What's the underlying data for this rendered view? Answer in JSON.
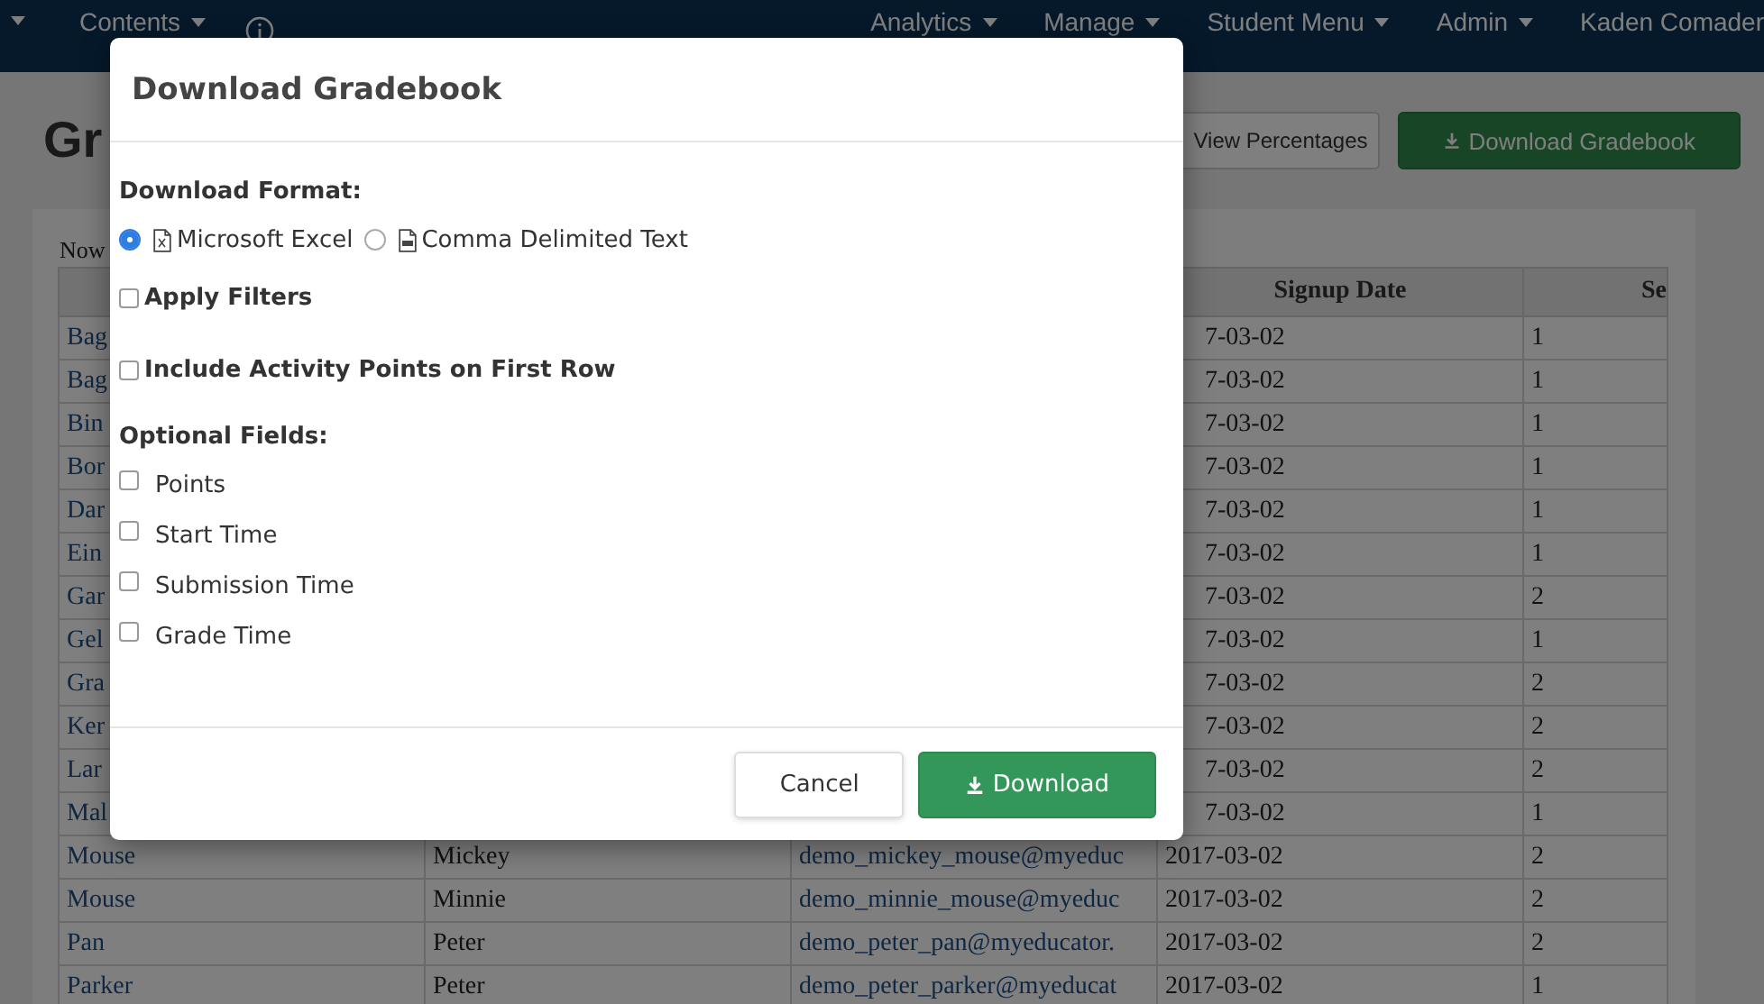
{
  "nav": {
    "left": [
      {
        "label": "Contents",
        "dropdown": true
      }
    ],
    "right": [
      {
        "label": "Analytics",
        "dropdown": true
      },
      {
        "label": "Manage",
        "dropdown": true
      },
      {
        "label": "Student Menu",
        "dropdown": true
      },
      {
        "label": "Admin",
        "dropdown": true
      },
      {
        "label": "Kaden Comader",
        "dropdown": false
      }
    ]
  },
  "page": {
    "title": "Gr",
    "buttons": [
      {
        "label": "View Percentages",
        "kind": "default"
      },
      {
        "label": "Download Gradebook",
        "kind": "primary"
      }
    ]
  },
  "summary": "Now",
  "table": {
    "columns": [
      {
        "label": "Signup Date"
      },
      {
        "label": "Se"
      }
    ],
    "rows": [
      {
        "column_1": "Bag",
        "column_4": "7-03-02",
        "column_5": "1"
      },
      {
        "column_1": "Bag",
        "column_4": "7-03-02",
        "column_5": "1"
      },
      {
        "column_1": "Bin",
        "column_4": "7-03-02",
        "column_5": "1"
      },
      {
        "column_1": "Bor",
        "column_4": "7-03-02",
        "column_5": "1"
      },
      {
        "column_1": "Dar",
        "column_4": "7-03-02",
        "column_5": "1"
      },
      {
        "column_1": "Ein",
        "column_4": "7-03-02",
        "column_5": "1"
      },
      {
        "column_1": "Gar",
        "column_4": "7-03-02",
        "column_5": "2"
      },
      {
        "column_1": "Gel",
        "column_4": "7-03-02",
        "column_5": "1"
      },
      {
        "column_1": "Gra",
        "column_4": "7-03-02",
        "column_5": "2"
      },
      {
        "column_1": "Ker",
        "column_4": "7-03-02",
        "column_5": "2"
      },
      {
        "column_1": "Lar",
        "column_4": "7-03-02",
        "column_5": "2"
      },
      {
        "column_1": "Mal",
        "column_4": "7-03-02",
        "column_5": "1"
      },
      {
        "column_1": "Mouse",
        "column_2": "Mickey",
        "column_3": "demo_mickey_mouse@myeduc",
        "column_4": "2017-03-02",
        "column_5": "2"
      },
      {
        "column_1": "Mouse",
        "column_2": "Minnie",
        "column_3": "demo_minnie_mouse@myeduc",
        "column_4": "2017-03-02",
        "column_5": "2"
      },
      {
        "column_1": "Pan",
        "column_2": "Peter",
        "column_3": "demo_peter_pan@myeducator.",
        "column_4": "2017-03-02",
        "column_5": "2"
      },
      {
        "column_1": "Parker",
        "column_2": "Peter",
        "column_3": "demo_peter_parker@myeducat",
        "column_4": "2017-03-02",
        "column_5": "1"
      }
    ]
  },
  "dialog": {
    "title": "Download Gradebook",
    "format_label": "Download Format:",
    "formats": [
      {
        "label": "Microsoft Excel",
        "kind": "excel",
        "selected": true
      },
      {
        "label": "Comma Delimited Text",
        "kind": "csv",
        "selected": false
      }
    ],
    "options": [
      {
        "label": "Apply Filters",
        "checked": false
      },
      {
        "label": "Include Activity Points on First Row",
        "checked": false
      }
    ],
    "optional_label": "Optional Fields:",
    "optional_fields": [
      {
        "label": "Points",
        "checked": false
      },
      {
        "label": "Start Time",
        "checked": false
      },
      {
        "label": "Submission Time",
        "checked": false
      },
      {
        "label": "Grade Time",
        "checked": false
      }
    ],
    "buttons": [
      {
        "label": "Cancel",
        "kind": "default"
      },
      {
        "label": "Download",
        "kind": "primary"
      }
    ]
  }
}
